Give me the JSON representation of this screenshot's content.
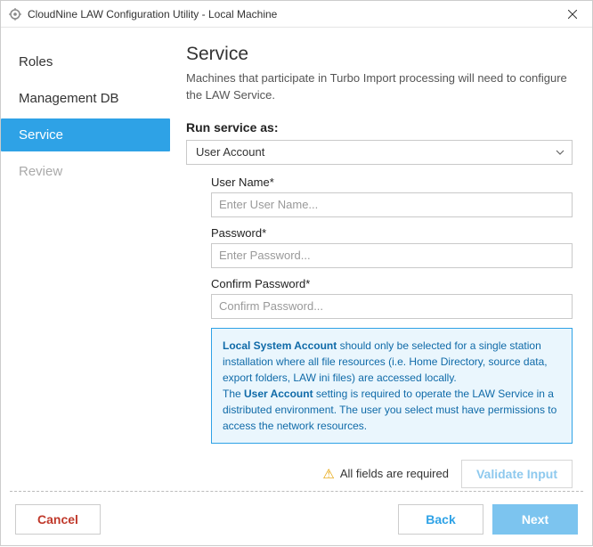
{
  "titlebar": {
    "title": "CloudNine LAW Configuration Utility - Local Machine"
  },
  "sidebar": {
    "items": [
      {
        "label": "Roles",
        "state": "normal"
      },
      {
        "label": "Management DB",
        "state": "normal"
      },
      {
        "label": "Service",
        "state": "active"
      },
      {
        "label": "Review",
        "state": "disabled"
      }
    ]
  },
  "main": {
    "heading": "Service",
    "subtitle": "Machines that participate in Turbo Import processing will need to configure the LAW Service.",
    "run_as_label": "Run service as:",
    "select_value": "User Account",
    "fields": {
      "username_label": "User Name*",
      "username_placeholder": "Enter User Name...",
      "password_label": "Password*",
      "password_placeholder": "Enter Password...",
      "confirm_label": "Confirm Password*",
      "confirm_placeholder": "Confirm Password..."
    },
    "info": {
      "b1": "Local System Account",
      "t1": " should only be selected for a single station installation where all file resources (i.e. Home Directory, source data, export folders, LAW ini files) are accessed locally.",
      "prefix2": "The ",
      "b2": "User Account",
      "t2": " setting is required to operate the LAW Service in a distributed environment. The user you select must have permissions to access the network resources."
    },
    "warn_text": "All fields are required",
    "validate_label": "Validate Input"
  },
  "footer": {
    "cancel": "Cancel",
    "back": "Back",
    "next": "Next"
  }
}
